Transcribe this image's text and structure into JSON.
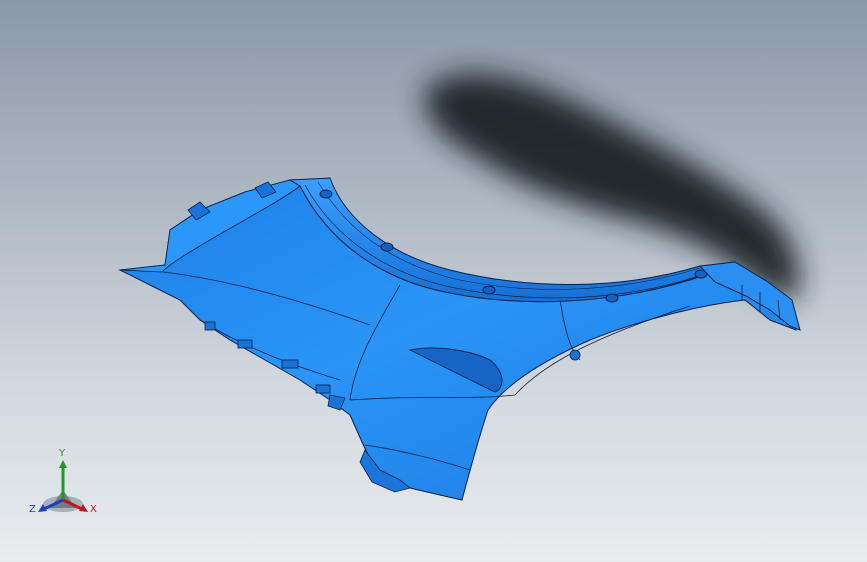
{
  "viewport": {
    "background_top": "#8b98a6",
    "background_bottom": "#e8ecef"
  },
  "model": {
    "body_color": "#1e88f0",
    "edge_color": "#0b1f46",
    "shadow_color": "#1d2227"
  },
  "triad": {
    "x_label": "X",
    "y_label": "Y",
    "z_label": "Z",
    "x_color": "#c4161c",
    "y_color": "#1f9a2a",
    "z_color": "#1d3fbf"
  }
}
